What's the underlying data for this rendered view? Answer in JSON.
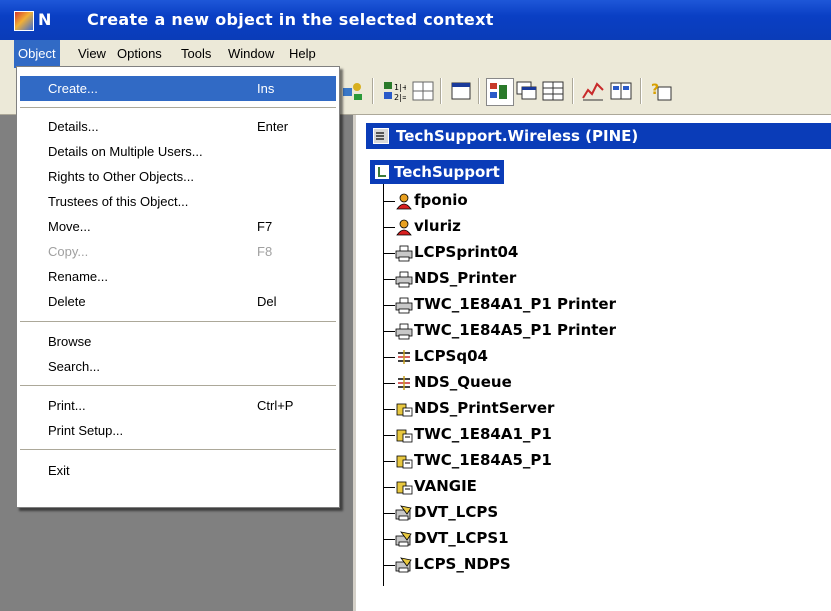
{
  "window": {
    "app_abbrev": "N",
    "title": "Create a new object in the selected context"
  },
  "menubar": {
    "items": [
      "Object",
      "View",
      "Options",
      "Tools",
      "Window",
      "Help"
    ]
  },
  "object_menu": {
    "items": [
      {
        "label": "Create...",
        "shortcut": "Ins"
      },
      {
        "label": "Details...",
        "shortcut": "Enter"
      },
      {
        "label": "Details on Multiple Users...",
        "shortcut": ""
      },
      {
        "label": "Rights to Other Objects...",
        "shortcut": ""
      },
      {
        "label": "Trustees of this Object...",
        "shortcut": ""
      },
      {
        "label": "Move...",
        "shortcut": "F7"
      },
      {
        "label": "Copy...",
        "shortcut": "F8"
      },
      {
        "label": "Rename...",
        "shortcut": ""
      },
      {
        "label": "Delete",
        "shortcut": "Del"
      },
      {
        "label": "Browse",
        "shortcut": ""
      },
      {
        "label": "Search...",
        "shortcut": ""
      },
      {
        "label": "Print...",
        "shortcut": "Ctrl+P"
      },
      {
        "label": "Print Setup...",
        "shortcut": ""
      },
      {
        "label": "Exit",
        "shortcut": ""
      }
    ]
  },
  "context": {
    "label": "TechSupport.Wireless (PINE)"
  },
  "tree": {
    "root": "TechSupport",
    "items": [
      {
        "label": "fponio",
        "icon": "user-icon"
      },
      {
        "label": "vluriz",
        "icon": "user-icon"
      },
      {
        "label": "LCPSprint04",
        "icon": "printer-icon"
      },
      {
        "label": "NDS_Printer",
        "icon": "printer-icon"
      },
      {
        "label": "TWC_1E84A1_P1 Printer",
        "icon": "printer-icon"
      },
      {
        "label": "TWC_1E84A5_P1 Printer",
        "icon": "printer-icon"
      },
      {
        "label": "LCPSq04",
        "icon": "print-queue-icon"
      },
      {
        "label": "NDS_Queue",
        "icon": "print-queue-icon"
      },
      {
        "label": "NDS_PrintServer",
        "icon": "print-server-icon"
      },
      {
        "label": "TWC_1E84A1_P1",
        "icon": "print-server-icon"
      },
      {
        "label": "TWC_1E84A5_P1",
        "icon": "print-server-icon"
      },
      {
        "label": "VANGIE",
        "icon": "print-server-icon"
      },
      {
        "label": "DVT_LCPS",
        "icon": "ndps-manager-icon"
      },
      {
        "label": "DVT_LCPS1",
        "icon": "ndps-manager-icon"
      },
      {
        "label": "LCPS_NDPS",
        "icon": "ndps-manager-icon"
      }
    ]
  },
  "colors": {
    "title_bar": "#0a3cb8",
    "selection": "#316ac5",
    "chrome": "#ece9d8",
    "workspace": "#808080"
  }
}
